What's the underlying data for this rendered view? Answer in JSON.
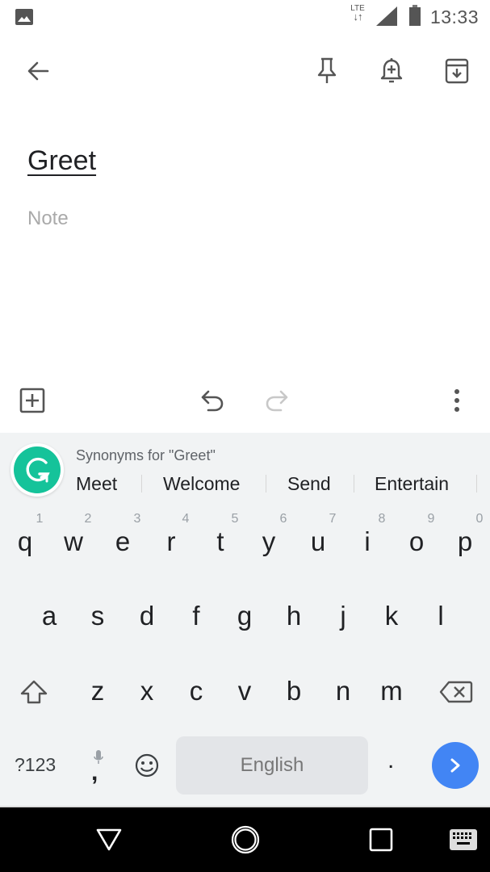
{
  "status_bar": {
    "network_type": "LTE",
    "time": "13:33",
    "icons": [
      "image-notification-icon",
      "data-arrows-icon",
      "signal-icon",
      "battery-icon"
    ]
  },
  "app_bar": {
    "back_icon": "arrow-left-icon",
    "actions": [
      "pin-icon",
      "reminder-add-icon",
      "archive-icon"
    ]
  },
  "note": {
    "title": "Greet",
    "body_placeholder": "Note"
  },
  "editor_toolbar": {
    "add_icon": "add-box-icon",
    "undo_icon": "undo-icon",
    "redo_icon": "redo-icon",
    "more_icon": "more-vert-icon"
  },
  "keyboard": {
    "suggestion_title": "Synonyms for \"Greet\"",
    "synonyms": [
      "Meet",
      "Welcome",
      "Send",
      "Entertain"
    ],
    "row1": [
      "q",
      "w",
      "e",
      "r",
      "t",
      "y",
      "u",
      "i",
      "o",
      "p"
    ],
    "row1_hints": [
      "1",
      "2",
      "3",
      "4",
      "5",
      "6",
      "7",
      "8",
      "9",
      "0"
    ],
    "row2": [
      "a",
      "s",
      "d",
      "f",
      "g",
      "h",
      "j",
      "k",
      "l"
    ],
    "row3": [
      "z",
      "x",
      "c",
      "v",
      "b",
      "n",
      "m"
    ],
    "symbols_label": "?123",
    "comma_label": ",",
    "space_label": "English",
    "period_label": ".",
    "accent_color": "#4285f4",
    "grammarly_color": "#15c39a"
  },
  "nav_bar": {
    "buttons": [
      "back-triangle-icon",
      "home-circle-icon",
      "recents-square-icon",
      "keyboard-switch-icon"
    ]
  }
}
